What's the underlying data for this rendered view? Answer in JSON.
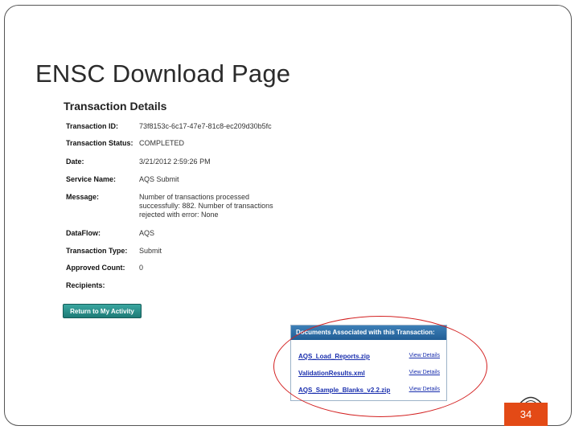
{
  "slide": {
    "title": "ENSC Download Page",
    "page_number": "34"
  },
  "details": {
    "title": "Transaction Details",
    "rows": [
      {
        "label": "Transaction ID:",
        "value": "73f8153c-6c17-47e7-81c8-ec209d30b5fc"
      },
      {
        "label": "Transaction Status:",
        "value": "COMPLETED"
      },
      {
        "label": "Date:",
        "value": "3/21/2012 2:59:26 PM"
      },
      {
        "label": "Service Name:",
        "value": "AQS Submit"
      },
      {
        "label": "Message:",
        "value": "Number of transactions processed successfully: 882. Number of transactions rejected with error: None"
      },
      {
        "label": "DataFlow:",
        "value": "AQS"
      },
      {
        "label": "Transaction Type:",
        "value": "Submit"
      },
      {
        "label": "Approved Count:",
        "value": "0"
      },
      {
        "label": "Recipients:",
        "value": ""
      }
    ],
    "return_button": "Return to My Activity"
  },
  "documents": {
    "header": "Documents Associated with this Transaction:",
    "items": [
      {
        "name": "AQS_Load_Reports.zip",
        "action": "View Details"
      },
      {
        "name": "ValidationResults.xml",
        "action": "View Details"
      },
      {
        "name": "AQS_Sample_Blanks_v2.2.zip",
        "action": "View Details"
      }
    ]
  },
  "colors": {
    "annotation_ellipse": "#d32020",
    "page_number_bg": "#e34a16",
    "button_bg": "#2a908b",
    "panel_header_bg": "#2d6ea7"
  }
}
